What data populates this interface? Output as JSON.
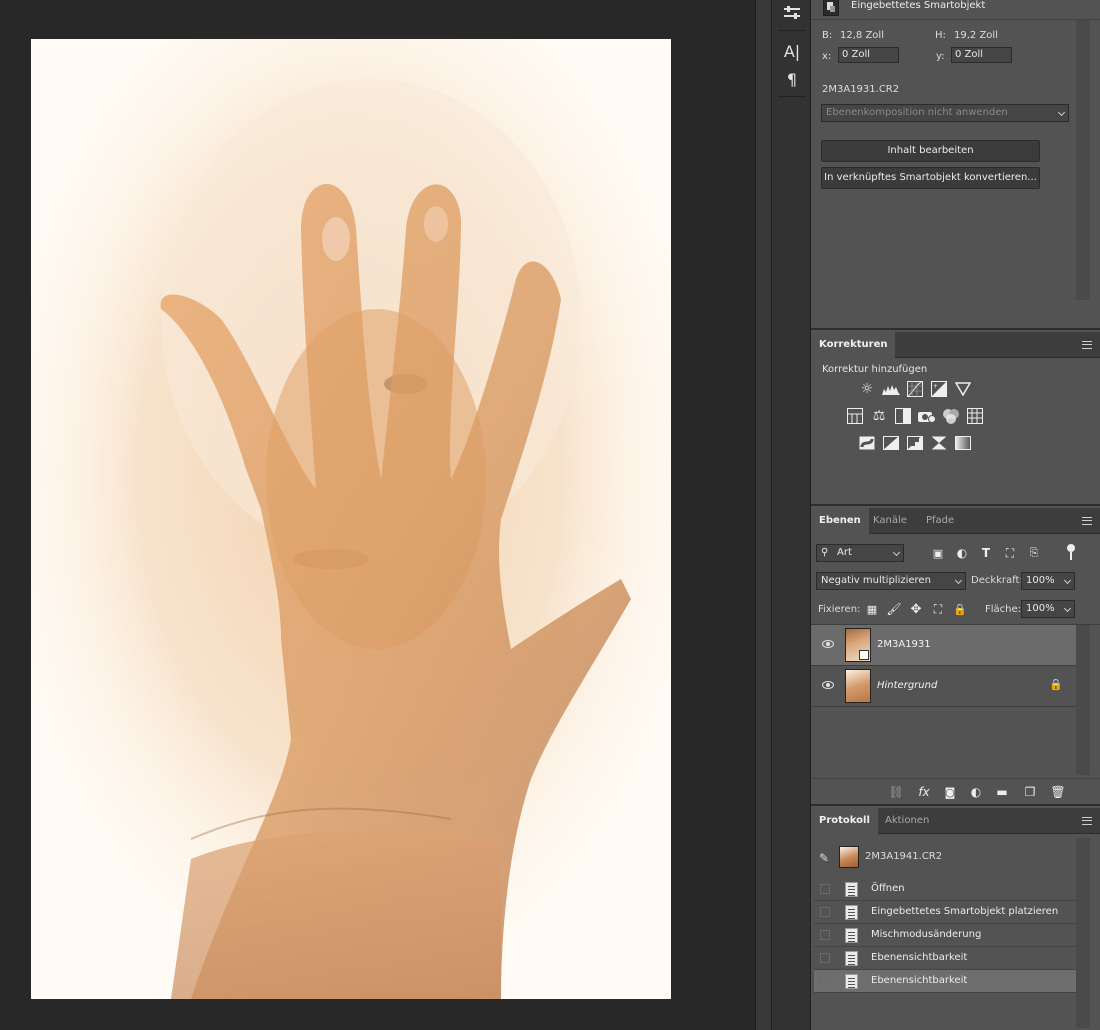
{
  "properties": {
    "title": "Eingebettetes Smartobjekt",
    "width_label": "B:",
    "width_value": "12,8 Zoll",
    "height_label": "H:",
    "height_value": "19,2 Zoll",
    "x_label": "x:",
    "x_value": "0 Zoll",
    "y_label": "y:",
    "y_value": "0 Zoll",
    "filename": "2M3A1931.CR2",
    "layer_comp_placeholder": "Ebenenkomposition nicht anwenden",
    "edit_button": "Inhalt bearbeiten",
    "convert_button": "In verknüpftes Smartobjekt konvertieren..."
  },
  "adjustments": {
    "tab": "Korrekturen",
    "subtitle": "Korrektur hinzufügen"
  },
  "layers": {
    "tabs": [
      "Ebenen",
      "Kanäle",
      "Pfade"
    ],
    "filter_label": "Art",
    "blend_mode": "Negativ multiplizieren",
    "opacity_label": "Deckkraft:",
    "opacity_value": "100%",
    "lock_label": "Fixieren:",
    "fill_label": "Fläche:",
    "fill_value": "100%",
    "items": [
      {
        "name": "2M3A1931",
        "selected": true,
        "locked": false
      },
      {
        "name": "Hintergrund",
        "selected": false,
        "locked": true
      }
    ]
  },
  "history": {
    "tabs": [
      "Protokoll",
      "Aktionen"
    ],
    "snapshot": "2M3A1941.CR2",
    "items": [
      "Öffnen",
      "Eingebettetes Smartobjekt platzieren",
      "Mischmodusänderung",
      "Ebenensichtbarkeit",
      "Ebenensichtbarkeit"
    ]
  },
  "colors": {
    "panel_bg": "#535353",
    "app_bg": "#282828",
    "selected_row": "#6b6b6b"
  }
}
